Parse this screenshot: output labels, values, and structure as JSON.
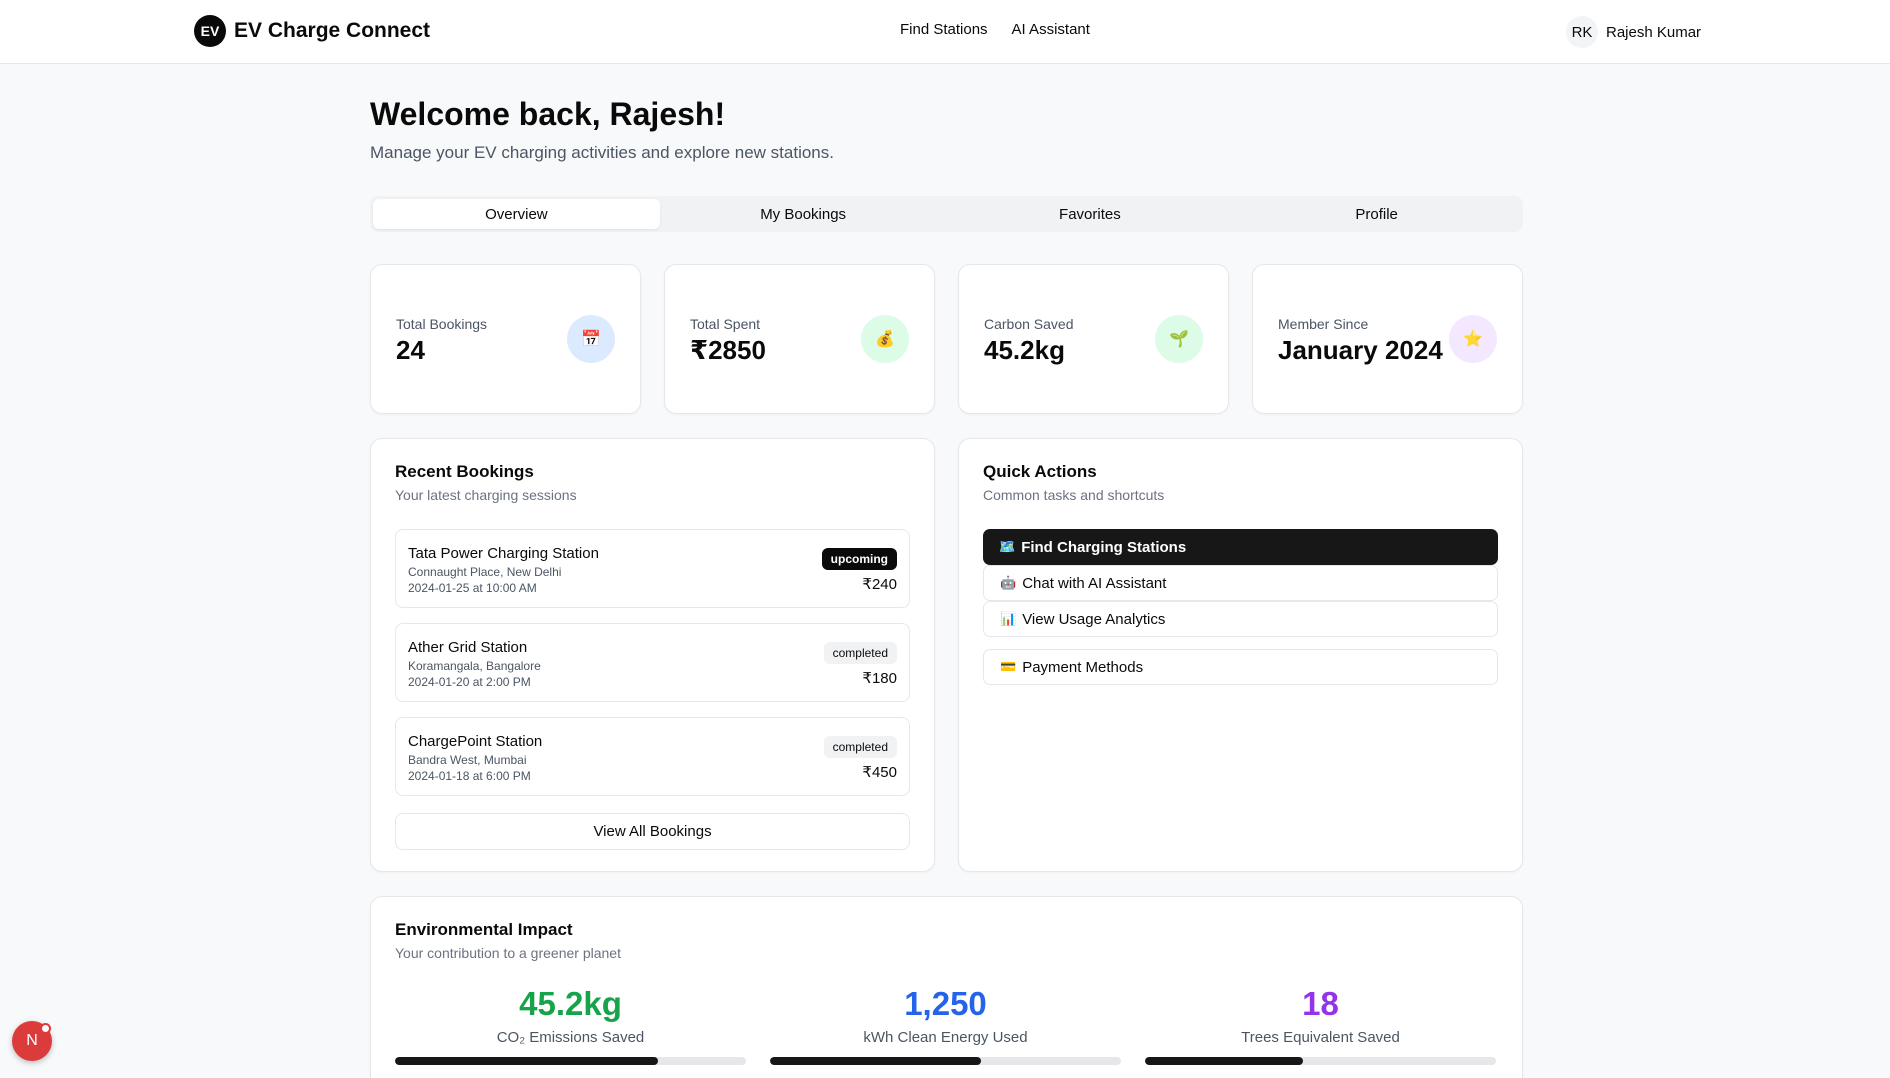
{
  "header": {
    "logo": "EV",
    "brand": "EV Charge Connect",
    "nav": [
      "Find Stations",
      "AI Assistant"
    ],
    "user_initials": "RK",
    "user_name": "Rajesh Kumar"
  },
  "welcome": {
    "title": "Welcome back, Rajesh!",
    "subtitle": "Manage your EV charging activities and explore new stations."
  },
  "tabs": [
    "Overview",
    "My Bookings",
    "Favorites",
    "Profile"
  ],
  "active_tab": "Overview",
  "stats": [
    {
      "label": "Total Bookings",
      "value": "24",
      "icon": "calendar-icon",
      "glyph": "📅",
      "color": "#dbeafe"
    },
    {
      "label": "Total Spent",
      "value": "₹2850",
      "icon": "money-bag-icon",
      "glyph": "💰",
      "color": "#dcfce7"
    },
    {
      "label": "Carbon Saved",
      "value": "45.2kg",
      "icon": "seedling-icon",
      "glyph": "🌱",
      "color": "#dcfce7"
    },
    {
      "label": "Member Since",
      "value": "January 2024",
      "icon": "star-icon",
      "glyph": "⭐",
      "color": "#f3e8ff"
    }
  ],
  "recent_bookings": {
    "title": "Recent Bookings",
    "subtitle": "Your latest charging sessions",
    "items": [
      {
        "name": "Tata Power Charging Station",
        "location": "Connaught Place, New Delhi",
        "datetime": "2024-01-25 at 10:00 AM",
        "status": "upcoming",
        "price": "₹240"
      },
      {
        "name": "Ather Grid Station",
        "location": "Koramangala, Bangalore",
        "datetime": "2024-01-20 at 2:00 PM",
        "status": "completed",
        "price": "₹180"
      },
      {
        "name": "ChargePoint Station",
        "location": "Bandra West, Mumbai",
        "datetime": "2024-01-18 at 6:00 PM",
        "status": "completed",
        "price": "₹450"
      }
    ],
    "view_all": "View All Bookings"
  },
  "quick_actions": {
    "title": "Quick Actions",
    "subtitle": "Common tasks and shortcuts",
    "items": [
      {
        "label": "Find Charging Stations",
        "icon": "map-icon",
        "glyph": "🗺️"
      },
      {
        "label": "Chat with AI Assistant",
        "icon": "robot-icon",
        "glyph": "🤖"
      },
      {
        "label": "View Usage Analytics",
        "icon": "bar-chart-icon",
        "glyph": "📊"
      },
      {
        "label": "Payment Methods",
        "icon": "credit-card-icon",
        "glyph": "💳"
      }
    ]
  },
  "environment": {
    "title": "Environmental Impact",
    "subtitle": "Your contribution to a greener planet",
    "metrics": [
      {
        "value": "45.2kg",
        "label": "CO₂ Emissions Saved",
        "color": "#16a34a",
        "progress": 0.75
      },
      {
        "value": "1,250",
        "label": "kWh Clean Energy Used",
        "color": "#2563eb",
        "progress": 0.6
      },
      {
        "value": "18",
        "label": "Trees Equivalent Saved",
        "color": "#9333ea",
        "progress": 0.45
      }
    ]
  },
  "floating_badge": "N"
}
